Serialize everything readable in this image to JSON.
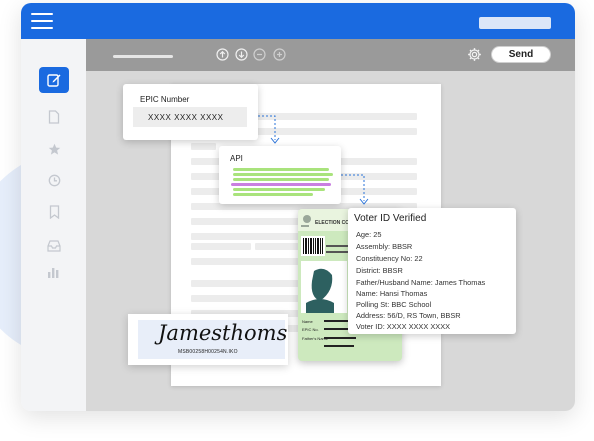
{
  "toolbar": {
    "send_label": "Send"
  },
  "epic_card": {
    "label": "EPIC Number",
    "value": "XXXX XXXX XXXX"
  },
  "api_card": {
    "label": "API"
  },
  "verify_card": {
    "title": "Voter ID Verified",
    "details": [
      "Age: 25",
      "Assembly: BBSR",
      "Constituency No: 22",
      "District: BBSR",
      "Father/Husband Name: James Thomas",
      "Name: Hansi Thomas",
      "Polling St: BBC School",
      "Address: 56/D, RS Town, BBSR",
      "Voter ID: XXXX XXXX XXXX"
    ]
  },
  "id_card": {
    "header": "ELECTION COM",
    "field_name": "Name",
    "field_epic": "EPIC No.",
    "field_father": "Father's Name"
  },
  "signature": {
    "text": "Jamesthoms",
    "code": "MSB00258H00254N.IKO"
  },
  "colors": {
    "accent": "#1a6ae0",
    "card_green": "#cde9be"
  },
  "icons": [
    "menu-icon",
    "edit-icon",
    "file-icon",
    "star-icon",
    "clock-icon",
    "bookmark-icon",
    "inbox-icon",
    "chart-icon",
    "upload-icon",
    "download-icon",
    "minus-icon",
    "plus-icon",
    "gear-icon"
  ]
}
